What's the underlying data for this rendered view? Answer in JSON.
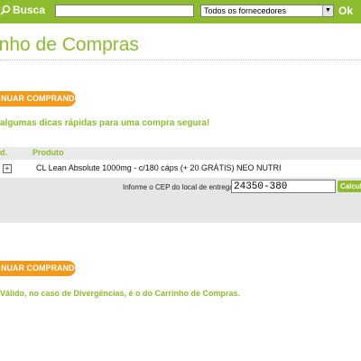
{
  "header": {
    "search_label": "Busca",
    "search_value": "",
    "supplier_select": "Todos os fornecedores",
    "ok_label": "Ok"
  },
  "page": {
    "title": "inho de Compras",
    "continue_top": "NUAR COMPRANDO",
    "tips": "algumas dicas rápidas para uma compra segura!",
    "continue_bottom": "NUAR COMPRANDO",
    "footer": "Válido, no caso de Divergências, é o do Carrinho de Compras."
  },
  "cart": {
    "col_qtd": "d.",
    "col_product": "Produto",
    "items": [
      {
        "name": "CL Lean Absolute 1000mg - c/180 cáps (+ 20 GRÁTIS) NEO NUTRI"
      }
    ],
    "cep_label": "Informe o CEP do local de entrega:",
    "cep_value": "24350-380",
    "calc_label": "Calcul"
  },
  "colors": {
    "brand_green": "#8dbc2e",
    "orange": "#f39a1c"
  },
  "icons": {
    "search": "magnifier-icon",
    "expand": "plus-box-icon",
    "dropdown": "chevron-down-icon"
  }
}
